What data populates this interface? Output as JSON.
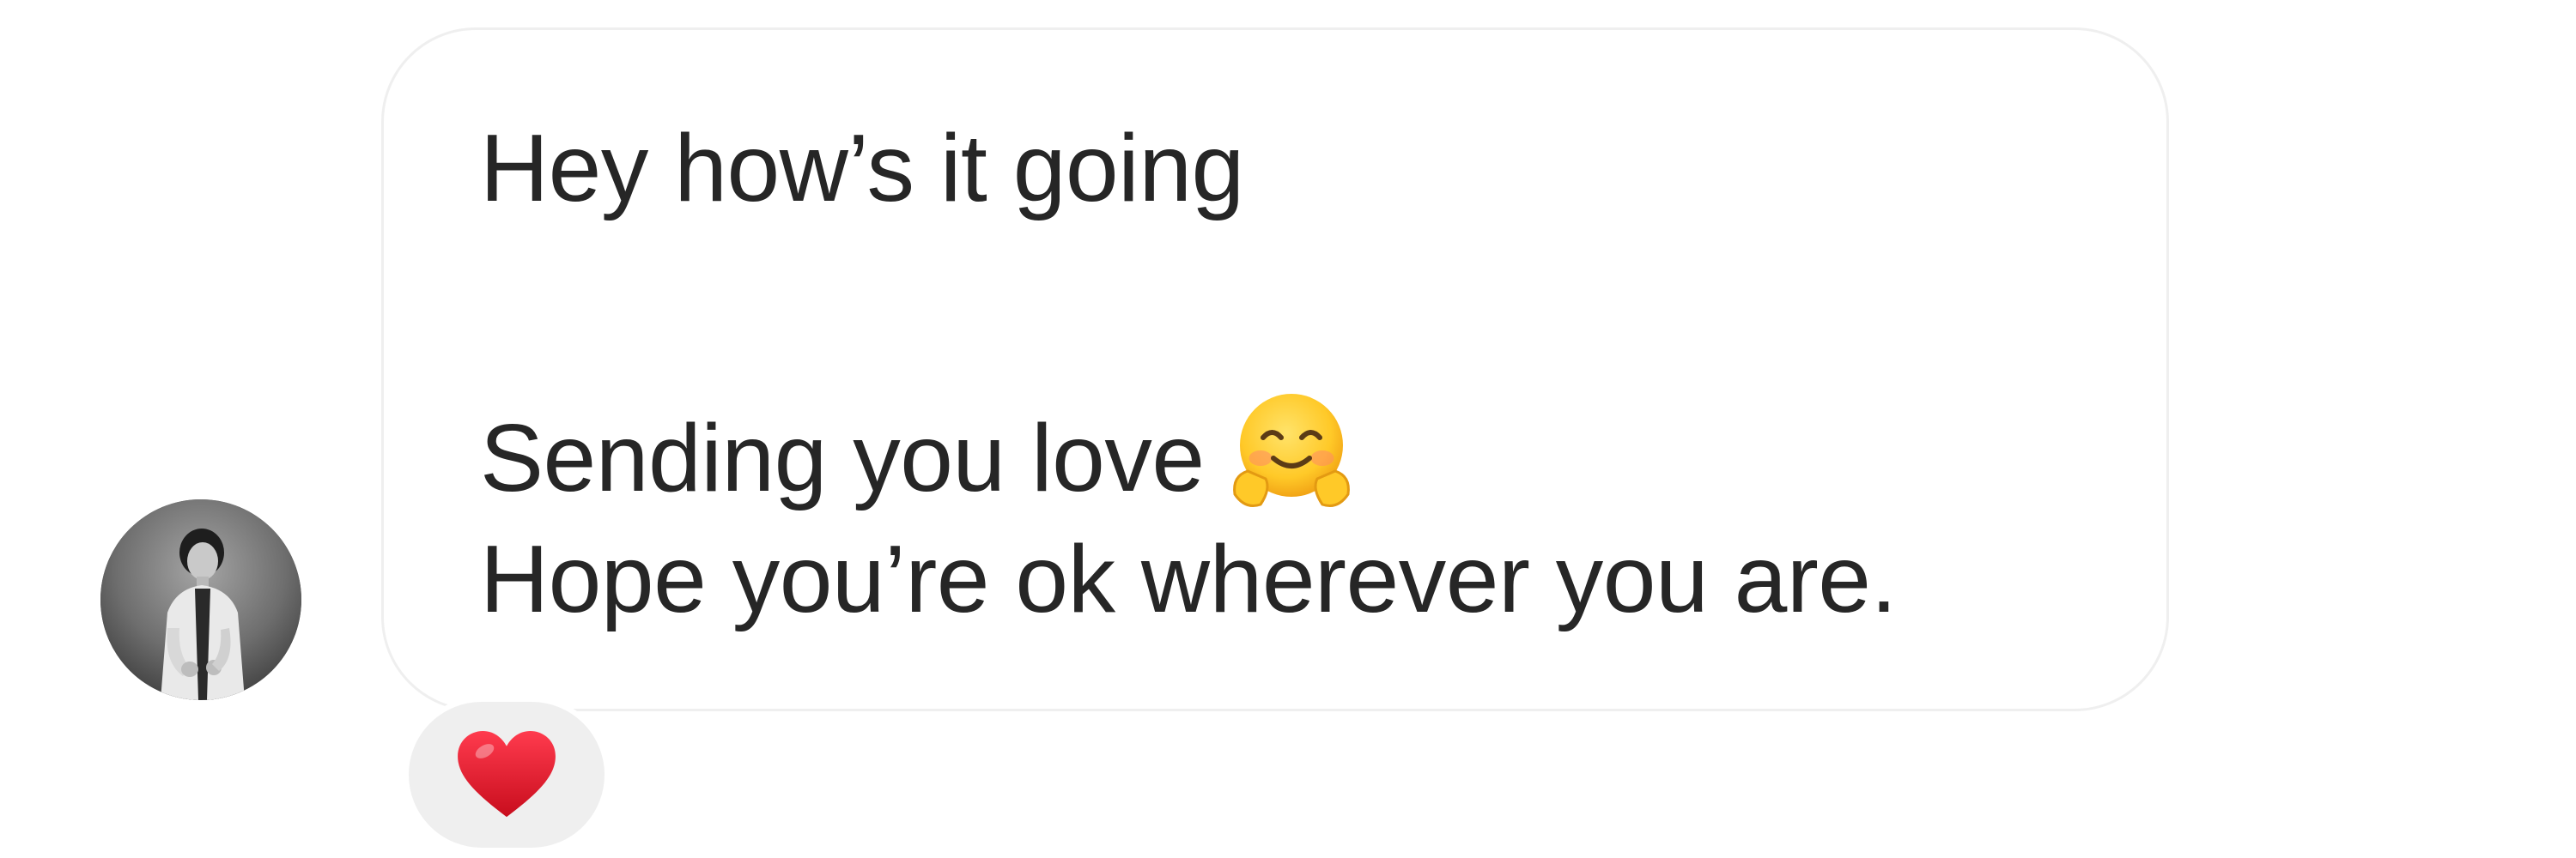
{
  "message": {
    "lines": [
      "Hey how’s it going",
      "Sending you love",
      "Hope you’re ok wherever you are."
    ],
    "inline_emoji": "smiling-face-with-open-hands",
    "reaction": "red-heart"
  },
  "avatar": {
    "style": "grayscale"
  },
  "colors": {
    "text": "#262626",
    "bubble_border": "#efefef",
    "reaction_background": "#efefef",
    "heart": "#e0142a"
  }
}
